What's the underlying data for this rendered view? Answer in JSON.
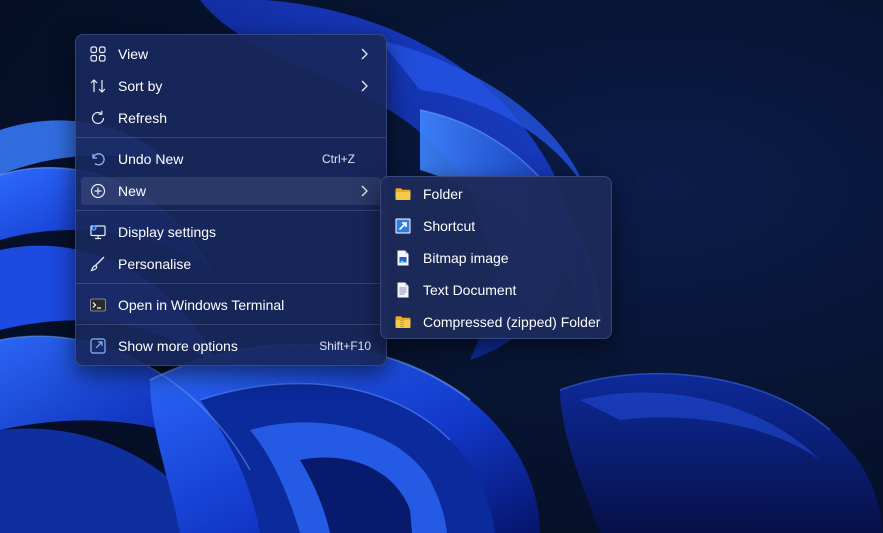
{
  "context_menu": {
    "items": [
      {
        "label": "View",
        "icon": "view-grid-icon",
        "submenu": true
      },
      {
        "label": "Sort by",
        "icon": "sort-icon",
        "submenu": true
      },
      {
        "label": "Refresh",
        "icon": "refresh-icon"
      },
      {
        "label": "Undo New",
        "icon": "undo-icon",
        "shortcut": "Ctrl+Z"
      },
      {
        "label": "New",
        "icon": "new-plus-icon",
        "submenu": true,
        "highlighted": true
      },
      {
        "label": "Display settings",
        "icon": "display-settings-icon"
      },
      {
        "label": "Personalise",
        "icon": "brush-icon"
      },
      {
        "label": "Open in Windows Terminal",
        "icon": "terminal-icon"
      },
      {
        "label": "Show more options",
        "icon": "show-more-icon",
        "shortcut": "Shift+F10"
      }
    ]
  },
  "new_submenu": {
    "items": [
      {
        "label": "Folder",
        "icon": "folder-icon"
      },
      {
        "label": "Shortcut",
        "icon": "shortcut-icon"
      },
      {
        "label": "Bitmap image",
        "icon": "bitmap-icon"
      },
      {
        "label": "Text Document",
        "icon": "text-document-icon"
      },
      {
        "label": "Compressed (zipped) Folder",
        "icon": "zip-folder-icon"
      }
    ]
  },
  "colors": {
    "menu_background": "#19285c",
    "icon_accent": "#8cb4ff",
    "folder_yellow": "#f7c948",
    "shortcut_blue": "#2e7de0"
  }
}
